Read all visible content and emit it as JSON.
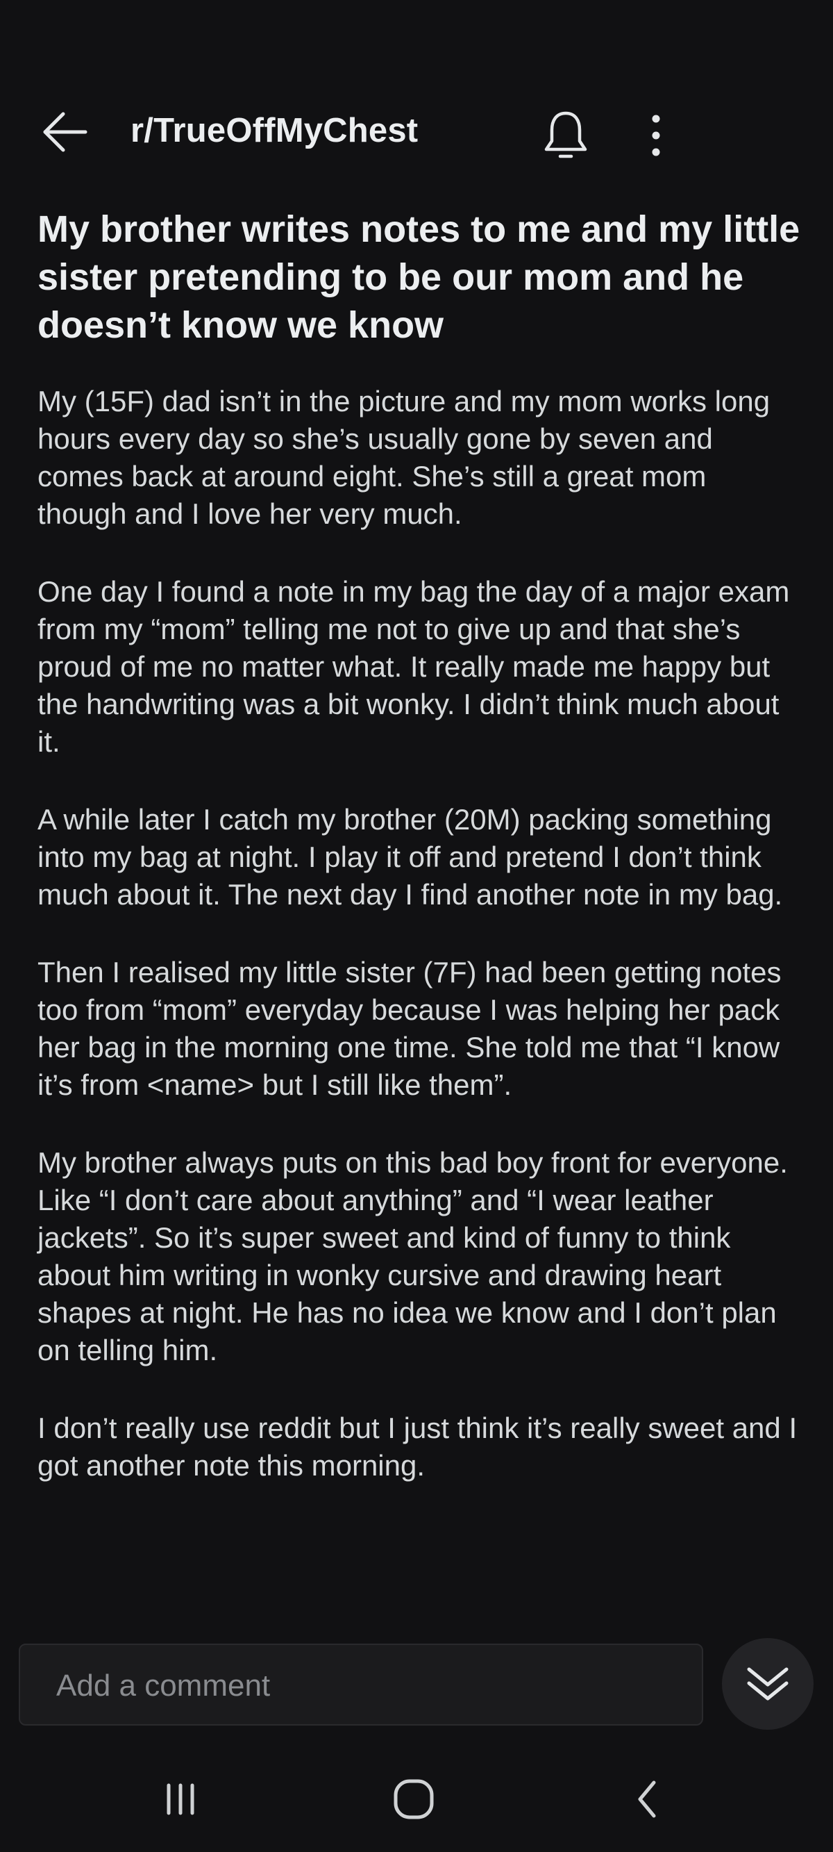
{
  "header": {
    "subreddit": "r/TrueOffMyChest",
    "back_icon": "arrow-left-icon",
    "bell_icon": "bell-icon",
    "more_icon": "more-vertical-icon"
  },
  "post": {
    "title": "My brother writes notes to me and my little sister pretending to be our mom and he doesn’t know we know",
    "paragraphs": [
      "My (15F) dad isn’t in the picture and my mom works long hours every day so she’s usually gone by seven and comes back at around eight. She’s still a great mom though and I love her very much.",
      "One day I found a note in my bag the day of a major exam from my “mom” telling me not to give up and that she’s proud of me no matter what. It really made me happy but the handwriting was a bit wonky. I didn’t think much about it.",
      "A while later I catch my brother (20M) packing something into my bag at night. I play it off and pretend I don’t think much about it. The next day I find another note in my bag.",
      "Then I realised my little sister (7F) had been getting notes too from “mom” everyday because I was helping her pack her bag in the morning one time. She told me that “I know it’s from <name> but I still like them”.",
      "My brother always puts on this bad boy front for everyone. Like “I don’t care about anything” and “I wear leather jackets”. So it’s super sweet and kind of funny to think about him writing in wonky cursive and drawing heart shapes at night. He has no idea we know and I don’t plan on telling him.",
      "I don’t really use reddit but I just think it’s really sweet and I got another note this morning."
    ]
  },
  "comment": {
    "placeholder": "Add a comment",
    "collapse_icon": "double-chevron-down-icon"
  },
  "system_nav": {
    "recent_icon": "recent-apps-icon",
    "home_icon": "home-icon",
    "back_icon": "nav-back-icon"
  },
  "colors": {
    "background": "#111113",
    "text": "#d7dadc",
    "title": "#eceef0",
    "input_bg": "#1b1b1d",
    "placeholder": "#8a8c90"
  }
}
